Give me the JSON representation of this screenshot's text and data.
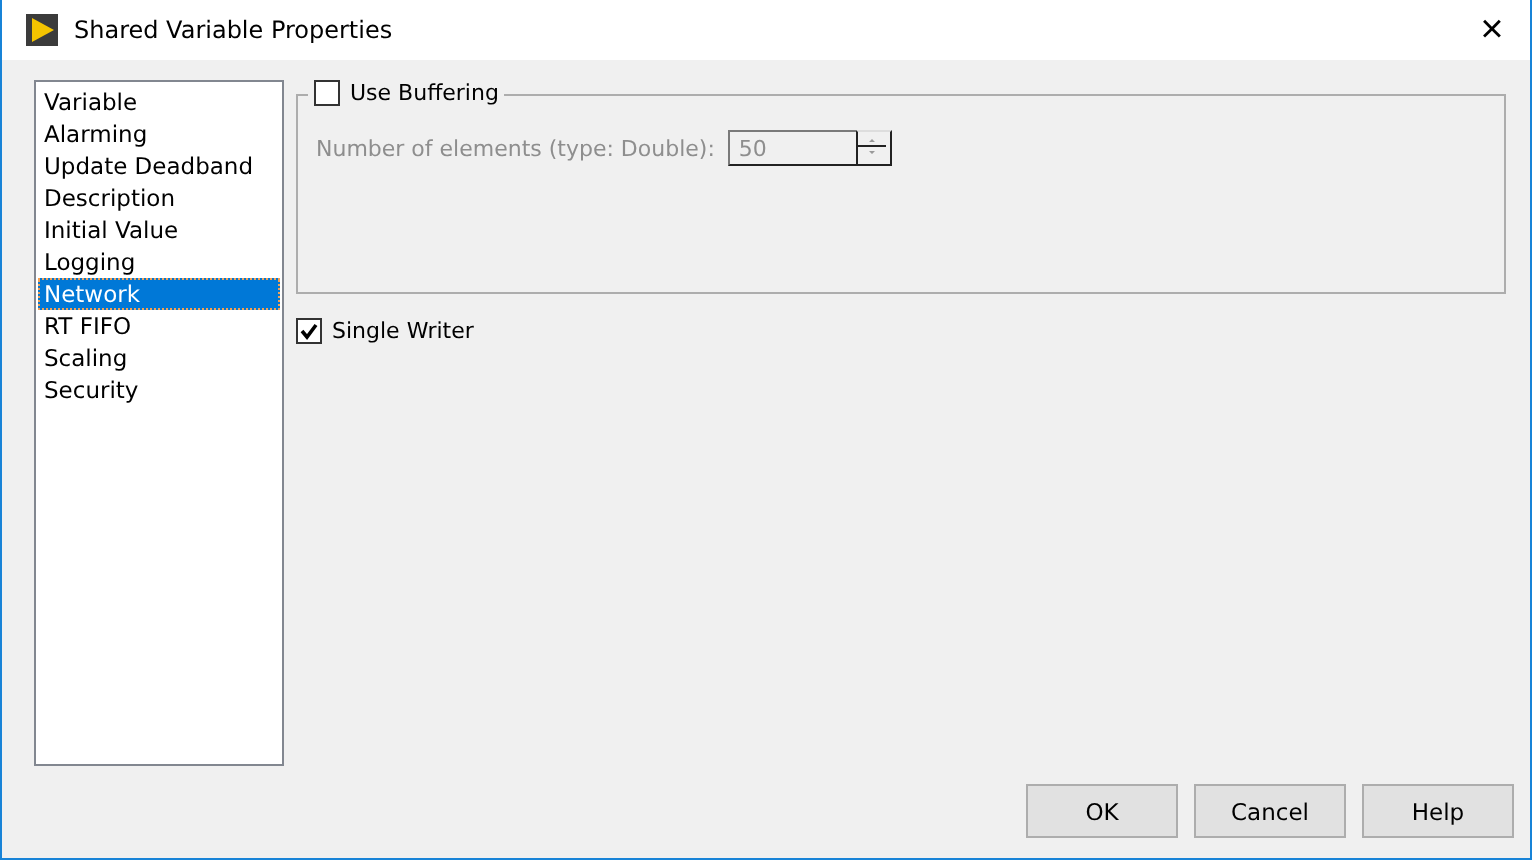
{
  "window": {
    "title": "Shared Variable Properties",
    "close": "×"
  },
  "sidebar": {
    "items": [
      {
        "label": "Variable",
        "selected": false
      },
      {
        "label": "Alarming",
        "selected": false
      },
      {
        "label": "Update Deadband",
        "selected": false
      },
      {
        "label": "Description",
        "selected": false
      },
      {
        "label": "Initial Value",
        "selected": false
      },
      {
        "label": "Logging",
        "selected": false
      },
      {
        "label": "Network",
        "selected": true
      },
      {
        "label": "RT FIFO",
        "selected": false
      },
      {
        "label": "Scaling",
        "selected": false
      },
      {
        "label": "Security",
        "selected": false
      }
    ]
  },
  "buffering": {
    "label": "Use Buffering",
    "checked": false,
    "field_label": "Number of elements (type: Double):",
    "value": "50",
    "disabled": true
  },
  "single_writer": {
    "label": "Single Writer",
    "checked": true
  },
  "buttons": [
    "OK",
    "Cancel",
    "Help"
  ]
}
